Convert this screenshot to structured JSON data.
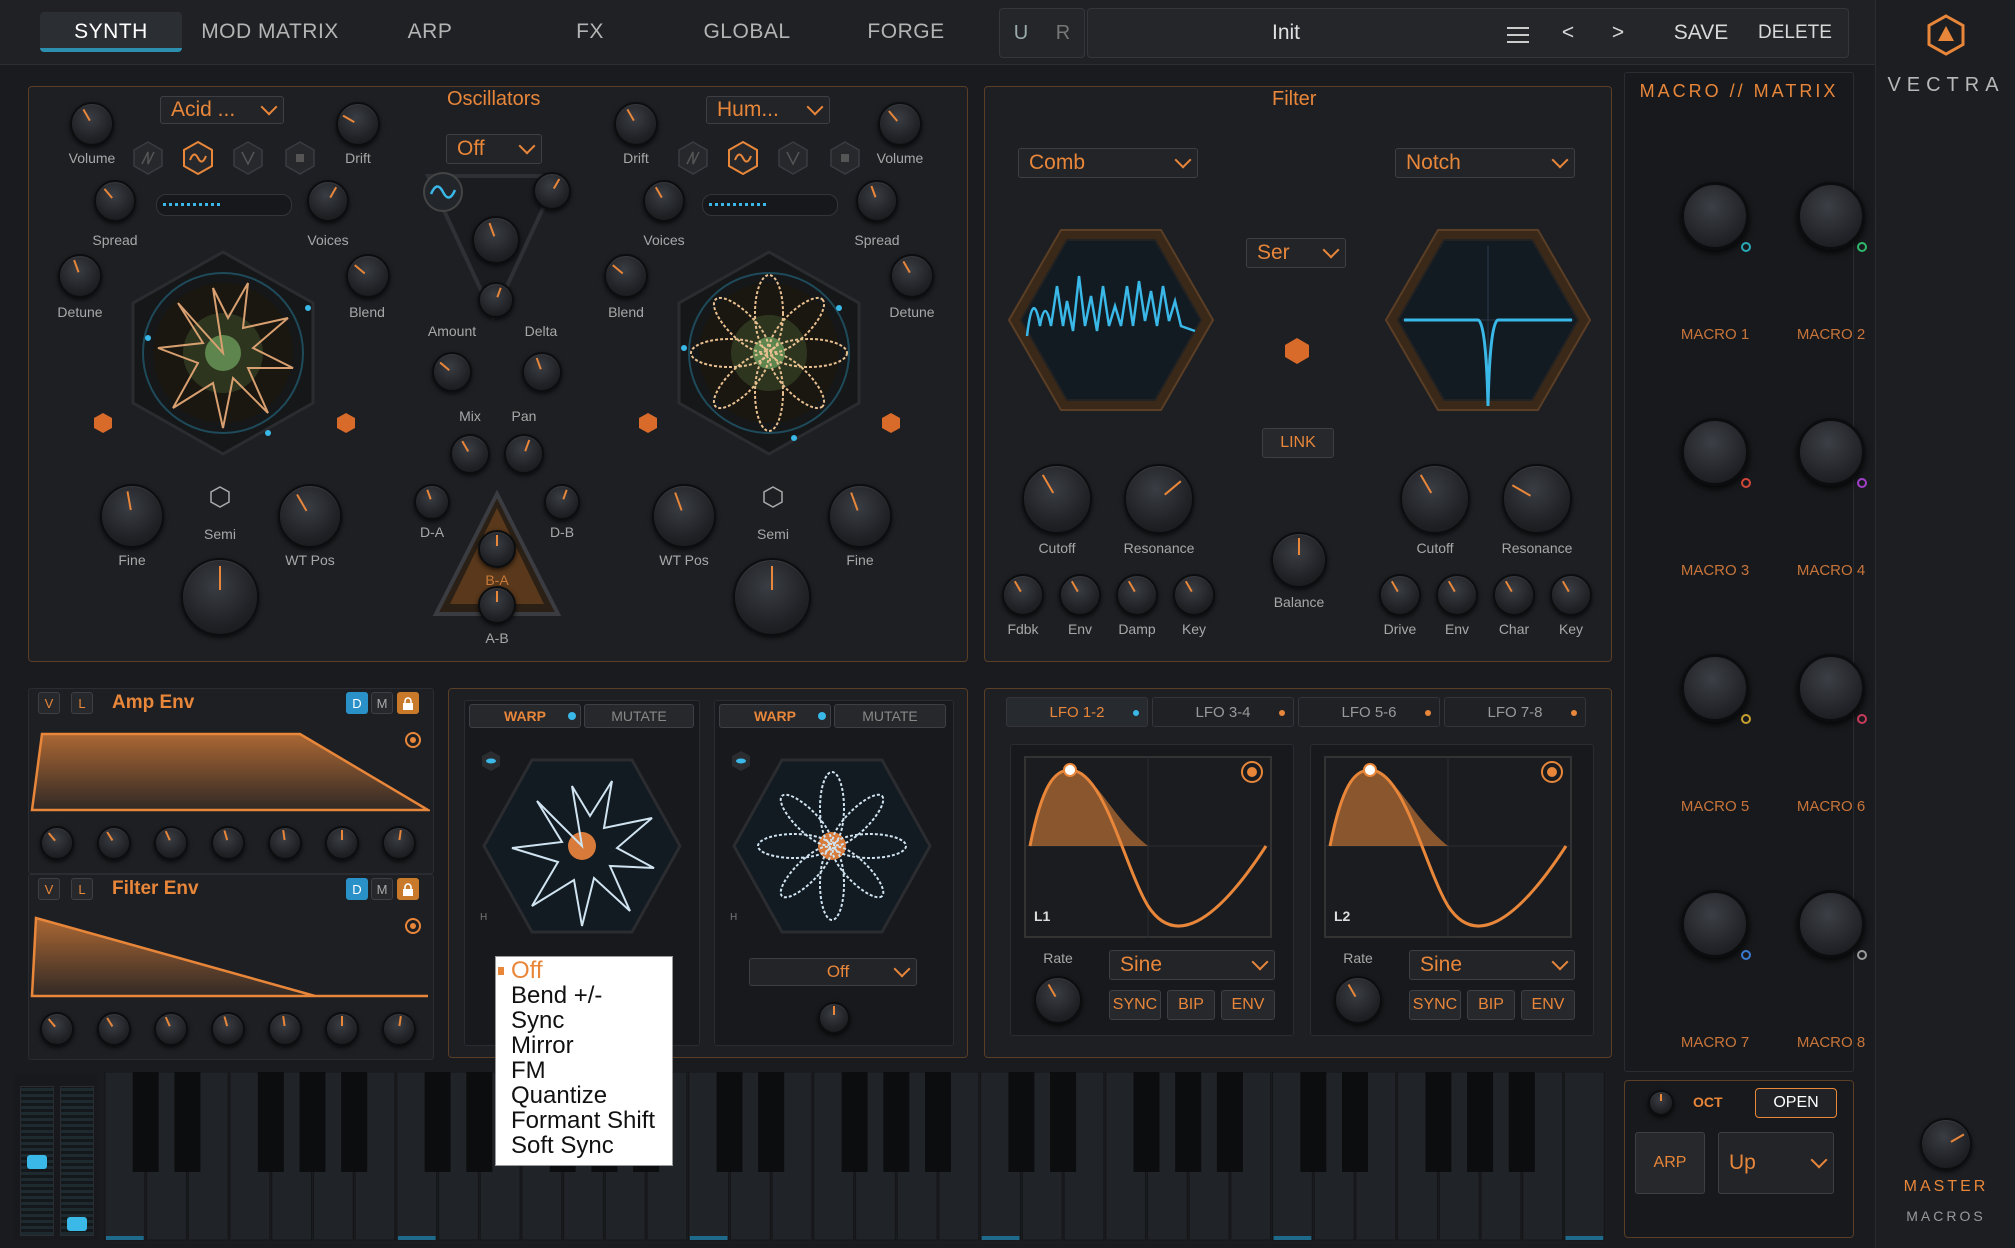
{
  "tabs": [
    {
      "label": "SYNTH",
      "active": true
    },
    {
      "label": "MOD MATRIX"
    },
    {
      "label": "ARP"
    },
    {
      "label": "FX"
    },
    {
      "label": "GLOBAL"
    },
    {
      "label": "FORGE"
    }
  ],
  "undo_redo": {
    "u": "U",
    "r": "R"
  },
  "preset": {
    "name": "Init",
    "save": "SAVE",
    "delete": "DELETE",
    "prev": "<",
    "next": ">"
  },
  "brand": {
    "name": "VECTRA"
  },
  "oscillators": {
    "title": "Oscillators",
    "osc1": {
      "wave": "Acid ...",
      "labels": {
        "volume": "Volume",
        "drift": "Drift",
        "spread": "Spread",
        "voices": "Voices",
        "detune": "Detune",
        "blend": "Blend",
        "fine": "Fine",
        "semi": "Semi",
        "wt_pos": "WT Pos"
      }
    },
    "osc2": {
      "wave": "Hum...",
      "labels": {
        "volume": "Volume",
        "drift": "Drift",
        "spread": "Spread",
        "voices": "Voices",
        "detune": "Detune",
        "blend": "Blend",
        "fine": "Fine",
        "semi": "Semi",
        "wt_pos": "WT Pos"
      }
    },
    "center": {
      "mode": "Off",
      "amount": "Amount",
      "delta": "Delta",
      "mix": "Mix",
      "pan": "Pan",
      "da": "D-A",
      "db": "D-B",
      "ba": "B-A",
      "ab": "A-B"
    }
  },
  "filter": {
    "title": "Filter",
    "f1_type": "Comb",
    "f2_type": "Notch",
    "routing": "Ser",
    "link": "LINK",
    "balance": "Balance",
    "f1": {
      "cutoff": "Cutoff",
      "resonance": "Resonance",
      "fdbk": "Fdbk",
      "env": "Env",
      "damp": "Damp",
      "key": "Key"
    },
    "f2": {
      "cutoff": "Cutoff",
      "resonance": "Resonance",
      "drive": "Drive",
      "env": "Env",
      "char": "Char",
      "key": "Key"
    }
  },
  "envelopes": {
    "amp": {
      "title": "Amp Env",
      "v": "V",
      "l": "L",
      "d": "D",
      "m": "M"
    },
    "filter": {
      "title": "Filter Env",
      "v": "V",
      "l": "L",
      "d": "D",
      "m": "M"
    }
  },
  "warp": {
    "a": {
      "warp": "WARP",
      "mutate": "MUTATE",
      "h": "H"
    },
    "b": {
      "warp": "WARP",
      "mutate": "MUTATE",
      "h": "H",
      "mode": "Off"
    }
  },
  "warp_menu": {
    "items": [
      "Off",
      "Bend +/-",
      "Sync",
      "Mirror",
      "FM",
      "Quantize",
      "Formant Shift",
      "Soft Sync"
    ],
    "selected": "Off"
  },
  "lfo": {
    "tabs": [
      {
        "label": "LFO 1-2",
        "active": true
      },
      {
        "label": "LFO 3-4"
      },
      {
        "label": "LFO 5-6"
      },
      {
        "label": "LFO 7-8"
      }
    ],
    "l1": {
      "name": "L1",
      "rate": "Rate",
      "shape": "Sine",
      "sync": "SYNC",
      "bip": "BIP",
      "env": "ENV"
    },
    "l2": {
      "name": "L2",
      "rate": "Rate",
      "shape": "Sine",
      "sync": "SYNC",
      "bip": "BIP",
      "env": "ENV"
    }
  },
  "macros": {
    "title": "MACRO // MATRIX",
    "items": [
      "MACRO 1",
      "MACRO 2",
      "MACRO 3",
      "MACRO 4",
      "MACRO 5",
      "MACRO 6",
      "MACRO 7",
      "MACRO 8"
    ],
    "dot_colors": [
      "#2aa8b8",
      "#2fb86a",
      "#d2453a",
      "#a040c8",
      "#c8a030",
      "#c83a5a",
      "#3a7ad0",
      "#999999"
    ]
  },
  "arp": {
    "oct": "OCT",
    "open": "OPEN",
    "arp": "ARP",
    "direction": "Up"
  },
  "master": {
    "label": "MASTER",
    "sub": "MACROS"
  },
  "colors": {
    "accent": "#e8863a",
    "cyan": "#3ab8e8",
    "panel_border": "#5a3e26"
  }
}
